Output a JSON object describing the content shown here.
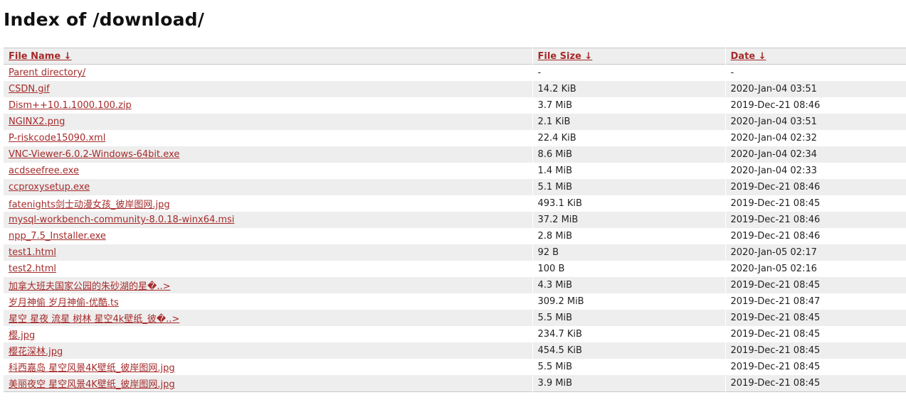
{
  "page": {
    "title": "Index of /download/"
  },
  "table": {
    "headers": {
      "name": "File Name  ↓",
      "size": "File Size  ↓",
      "date": "Date  ↓"
    },
    "rows": [
      {
        "name": "Parent directory/",
        "size": "-",
        "date": "-"
      },
      {
        "name": "CSDN.gif",
        "size": "14.2 KiB",
        "date": "2020-Jan-04 03:51"
      },
      {
        "name": "Dism++10.1.1000.100.zip",
        "size": "3.7 MiB",
        "date": "2019-Dec-21 08:46"
      },
      {
        "name": "NGINX2.png",
        "size": "2.1 KiB",
        "date": "2020-Jan-04 03:51"
      },
      {
        "name": "P-riskcode15090.xml",
        "size": "22.4 KiB",
        "date": "2020-Jan-04 02:32"
      },
      {
        "name": "VNC-Viewer-6.0.2-Windows-64bit.exe",
        "size": "8.6 MiB",
        "date": "2020-Jan-04 02:34"
      },
      {
        "name": "acdseefree.exe",
        "size": "1.4 MiB",
        "date": "2020-Jan-04 02:33"
      },
      {
        "name": "ccproxysetup.exe",
        "size": "5.1 MiB",
        "date": "2019-Dec-21 08:46"
      },
      {
        "name": "fatenights剑士动漫女孩_彼岸图网.jpg",
        "size": "493.1 KiB",
        "date": "2019-Dec-21 08:45"
      },
      {
        "name": "mysql-workbench-community-8.0.18-winx64.msi",
        "size": "37.2 MiB",
        "date": "2019-Dec-21 08:46"
      },
      {
        "name": "npp_7.5_Installer.exe",
        "size": "2.8 MiB",
        "date": "2019-Dec-21 08:46"
      },
      {
        "name": "test1.html",
        "size": "92 B",
        "date": "2020-Jan-05 02:17"
      },
      {
        "name": "test2.html",
        "size": "100 B",
        "date": "2020-Jan-05 02:16"
      },
      {
        "name": "加拿大班夫国家公园的朱砂湖的星�..>",
        "size": "4.3 MiB",
        "date": "2019-Dec-21 08:45"
      },
      {
        "name": "岁月神偷 岁月神偷-优酷.ts",
        "size": "309.2 MiB",
        "date": "2019-Dec-21 08:47"
      },
      {
        "name": "星空 星夜 流星 树林 星空4k壁纸_彼�..>",
        "size": "5.5 MiB",
        "date": "2019-Dec-21 08:45"
      },
      {
        "name": "樱.jpg",
        "size": "234.7 KiB",
        "date": "2019-Dec-21 08:45"
      },
      {
        "name": "樱花深林.jpg",
        "size": "454.5 KiB",
        "date": "2019-Dec-21 08:45"
      },
      {
        "name": "科西嘉岛 星空风景4K壁纸_彼岸图网.jpg",
        "size": "5.5 MiB",
        "date": "2019-Dec-21 08:45"
      },
      {
        "name": "美丽夜空 星空风景4K壁纸_彼岸图网.jpg",
        "size": "3.9 MiB",
        "date": "2019-Dec-21 08:45"
      }
    ]
  },
  "colors": {
    "link": "#a52a2a",
    "stripe": "#eeeeee",
    "text": "#222222"
  }
}
